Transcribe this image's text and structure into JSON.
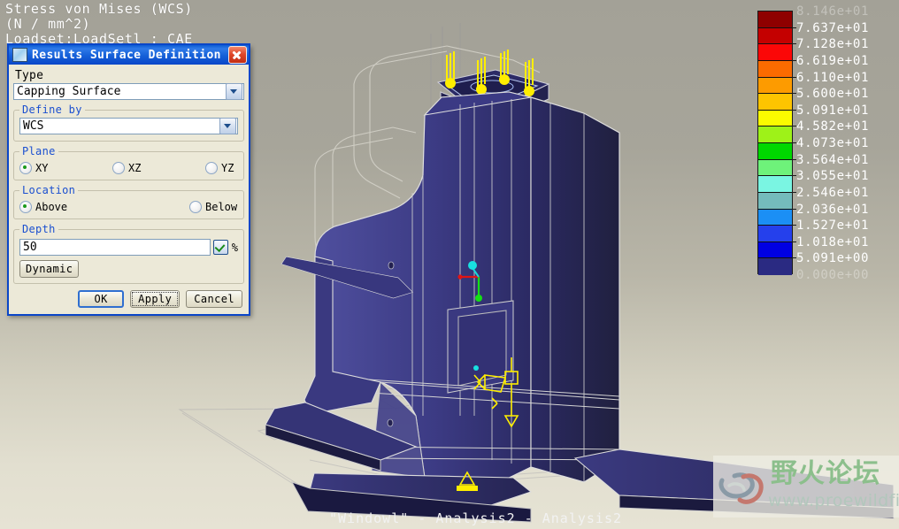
{
  "window": {
    "result_caption": "Stress von Mises (WCS)\n(N / mm^2)\nLoadset:LoadSetl : CAE",
    "bottom_caption": "\"Windowl\" - Analysis2 - Analysis2"
  },
  "legend": {
    "labels": [
      "8.146e+01",
      "7.637e+01",
      "7.128e+01",
      "6.619e+01",
      "6.110e+01",
      "5.600e+01",
      "5.091e+01",
      "4.582e+01",
      "4.073e+01",
      "3.564e+01",
      "3.055e+01",
      "2.546e+01",
      "2.036e+01",
      "1.527e+01",
      "1.018e+01",
      "5.091e+00",
      "0.000e+00"
    ],
    "colors": [
      "#8f0000",
      "#c40000",
      "#fb0707",
      "#fb6b00",
      "#fd9b00",
      "#fdc400",
      "#fbfb00",
      "#9ef218",
      "#00d800",
      "#6ef27a",
      "#7af5e2",
      "#74bcbc",
      "#1b8ff5",
      "#2540ec",
      "#0000e3",
      "#2a2a82"
    ]
  },
  "dialog": {
    "title": "Results Surface Definition",
    "close_label": "Close",
    "type_label": "Type",
    "type_value": "Capping Surface",
    "define_by_label": "Define by",
    "define_by_value": "WCS",
    "plane_label": "Plane",
    "plane_options": [
      {
        "label": "XY",
        "selected": true
      },
      {
        "label": "XZ",
        "selected": false
      },
      {
        "label": "YZ",
        "selected": false
      }
    ],
    "location_label": "Location",
    "location_options": [
      {
        "label": "Above",
        "selected": true
      },
      {
        "label": "Below",
        "selected": false
      }
    ],
    "depth_label": "Depth",
    "depth_value": "50",
    "depth_unit": "%",
    "dynamic_label": "Dynamic",
    "ok_label": "OK",
    "apply_label": "Apply",
    "cancel_label": "Cancel"
  },
  "watermark": {
    "text": "野火论坛",
    "url": "www.proewildfire.cn"
  },
  "colors": {
    "model_fill": "#2e2d6b",
    "model_fill_light": "#4a4a96",
    "wireframe": "#e6e6e6",
    "load_arrow": "#ffee00",
    "accent_blue": "#0a46c8",
    "dialog_face": "#ece9d8"
  }
}
